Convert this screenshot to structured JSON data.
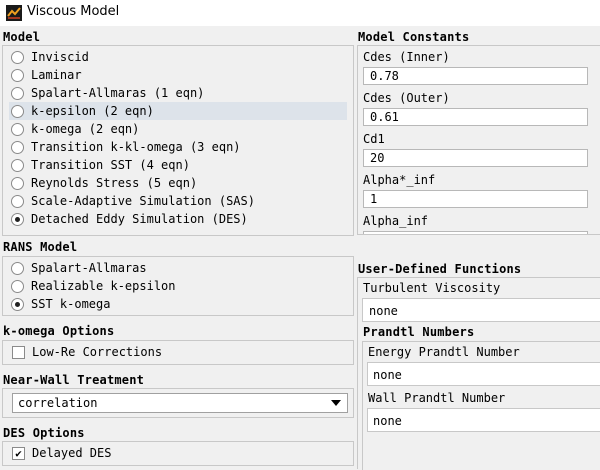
{
  "window": {
    "title": "Viscous Model"
  },
  "model": {
    "header": "Model",
    "options": [
      {
        "label": "Inviscid",
        "selected": false
      },
      {
        "label": "Laminar",
        "selected": false
      },
      {
        "label": "Spalart-Allmaras (1 eqn)",
        "selected": false
      },
      {
        "label": "k-epsilon (2 eqn)",
        "selected": false
      },
      {
        "label": "k-omega (2 eqn)",
        "selected": false
      },
      {
        "label": "Transition k-kl-omega (3 eqn)",
        "selected": false
      },
      {
        "label": "Transition SST (4 eqn)",
        "selected": false
      },
      {
        "label": "Reynolds Stress (5 eqn)",
        "selected": false
      },
      {
        "label": "Scale-Adaptive Simulation (SAS)",
        "selected": false
      },
      {
        "label": "Detached Eddy Simulation (DES)",
        "selected": true
      }
    ]
  },
  "rans": {
    "header": "RANS Model",
    "options": [
      {
        "label": "Spalart-Allmaras",
        "selected": false
      },
      {
        "label": "Realizable k-epsilon",
        "selected": false
      },
      {
        "label": "SST k-omega",
        "selected": true
      }
    ]
  },
  "komega": {
    "header": "k-omega Options",
    "low_re_label": "Low-Re Corrections",
    "low_re_checked": false
  },
  "near_wall": {
    "header": "Near-Wall Treatment",
    "value": "correlation"
  },
  "des": {
    "header": "DES Options",
    "delayed_label": "Delayed DES",
    "delayed_checked": true,
    "check_glyph": "✔"
  },
  "constants": {
    "header": "Model Constants",
    "items": [
      {
        "label": "Cdes (Inner)",
        "value": "0.78"
      },
      {
        "label": "Cdes (Outer)",
        "value": "0.61"
      },
      {
        "label": "Cd1",
        "value": "20"
      },
      {
        "label": "Alpha*_inf",
        "value": "1"
      },
      {
        "label": "Alpha_inf",
        "value": ""
      }
    ]
  },
  "udf": {
    "header": "User-Defined Functions",
    "turbulent_viscosity_label": "Turbulent Viscosity",
    "turbulent_viscosity_value": "none",
    "prandtl_header": "Prandtl Numbers",
    "energy_label": "Energy Prandtl Number",
    "energy_value": "none",
    "wall_label": "Wall Prandtl Number",
    "wall_value": "none"
  }
}
